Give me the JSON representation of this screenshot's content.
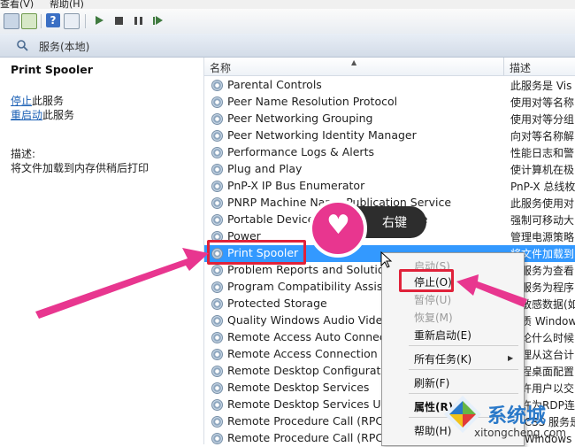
{
  "menubar": {
    "items": [
      "查看(V)",
      "帮助(H)"
    ]
  },
  "header": {
    "title": "服务(本地)"
  },
  "left_pane": {
    "title": "Print Spooler",
    "stop_link": "停止",
    "stop_suffix": "此服务",
    "restart_link": "重启动",
    "restart_suffix": "此服务",
    "desc_label": "描述:",
    "desc_text": "将文件加载到内存供稍后打印"
  },
  "columns": {
    "name": "名称",
    "desc": "描述"
  },
  "services": [
    {
      "name": "Parental Controls",
      "desc": "此服务是 Vis"
    },
    {
      "name": "Peer Name Resolution Protocol",
      "desc": "使用对等名称"
    },
    {
      "name": "Peer Networking Grouping",
      "desc": "使用对等分组"
    },
    {
      "name": "Peer Networking Identity Manager",
      "desc": "向对等名称解"
    },
    {
      "name": "Performance Logs & Alerts",
      "desc": "性能日志和警"
    },
    {
      "name": "Plug and Play",
      "desc": "使计算机在极"
    },
    {
      "name": "PnP-X IP Bus Enumerator",
      "desc": "PnP-X 总线枚"
    },
    {
      "name": "PNRP Machine Name Publication Service",
      "desc": "此服务使用对"
    },
    {
      "name": "Portable Device Enumerator Service",
      "desc": "强制可移动大"
    },
    {
      "name": "Power",
      "desc": "管理电源策略"
    },
    {
      "name": "Print Spooler",
      "desc": "将文件加载到"
    },
    {
      "name": "Problem Reports and Solutions",
      "desc": "此服务为查看"
    },
    {
      "name": "Program Compatibility Assistant",
      "desc": "此服务为程序"
    },
    {
      "name": "Protected Storage",
      "desc": "为敏感数据(如"
    },
    {
      "name": "Quality Windows Audio Video",
      "desc": "优质 Windows"
    },
    {
      "name": "Remote Access Auto Connection",
      "desc": "无论什么时候"
    },
    {
      "name": "Remote Access Connection",
      "desc": "管理从这台计"
    },
    {
      "name": "Remote Desktop Configuration",
      "desc": "远程桌面配置"
    },
    {
      "name": "Remote Desktop Services",
      "desc": "允许用户以交"
    },
    {
      "name": "Remote Desktop Services U",
      "desc": "允许为RDP连"
    },
    {
      "name": "Remote Procedure Call (RPC)",
      "desc": "RPCSS 服务是"
    },
    {
      "name": "Remote Procedure Call (RPC)",
      "desc": "在 Windows 2"
    }
  ],
  "context_menu": {
    "start": "启动(S)",
    "stop": "停止(O)",
    "pause": "暂停(U)",
    "resume": "恢复(M)",
    "restart": "重新启动(E)",
    "all_tasks": "所有任务(K)",
    "refresh": "刷新(F)",
    "properties": "属性(R)",
    "help": "帮助(H)"
  },
  "annotation": {
    "label": "右键"
  },
  "watermark": {
    "brand": "系统城",
    "url": "xitongcheng.com"
  },
  "colors": {
    "selection": "#3399ff",
    "annotation_red": "#e0223a",
    "annotation_pink": "#e8368f",
    "link": "#1a5fb4"
  }
}
